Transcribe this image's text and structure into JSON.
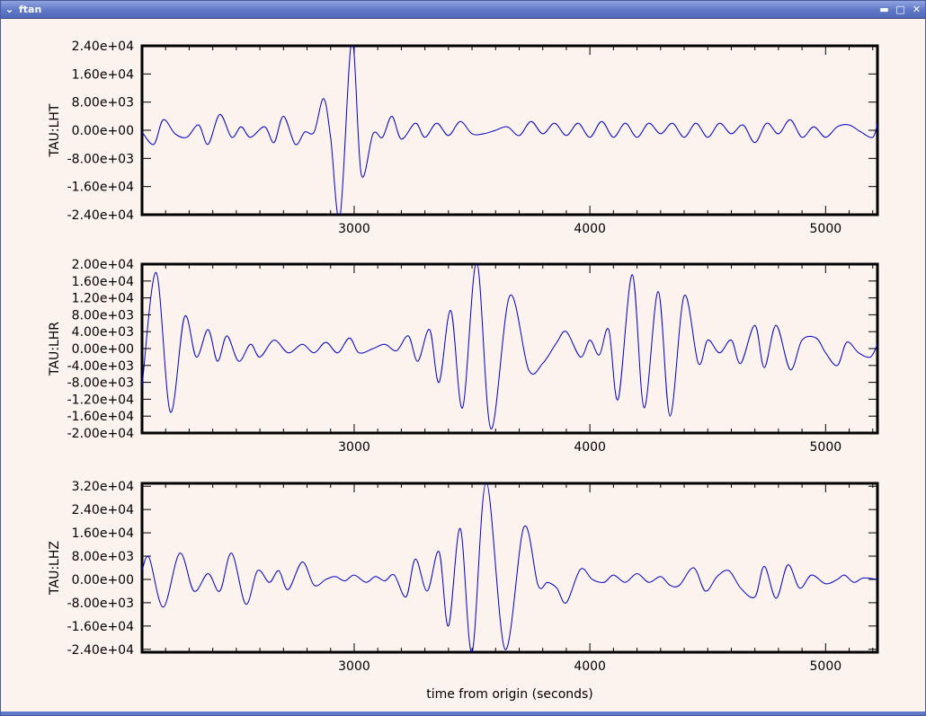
{
  "window": {
    "title": "ftan",
    "menu_icon": "chevron-down-icon",
    "minimize_icon": "minimize-icon",
    "maximize_icon": "maximize-icon",
    "close_icon": "close-icon"
  },
  "colors": {
    "trace": "#0000cc",
    "background": "#fcf2ee",
    "titlebar": "#5f78c8"
  },
  "xlabel": "time from origin (seconds)",
  "chart_data": [
    {
      "type": "line",
      "ylabel": "TAU:LHT",
      "xlim": [
        2100,
        5220
      ],
      "ylim": [
        -24000,
        24000
      ],
      "xticks": [
        "3000",
        "4000",
        "5000"
      ],
      "yticks": [
        "2.40e+04",
        "1.60e+04",
        "8.00e+03",
        "0.00e+00",
        "-8.00e+03",
        "-1.60e+04",
        "-2.40e+04"
      ],
      "series": [
        {
          "values": [
            [
              2100,
              -500
            ],
            [
              2150,
              -4000
            ],
            [
              2190,
              3000
            ],
            [
              2240,
              -1000
            ],
            [
              2290,
              -2000
            ],
            [
              2340,
              1500
            ],
            [
              2380,
              -4000
            ],
            [
              2430,
              4500
            ],
            [
              2480,
              -2000
            ],
            [
              2520,
              1000
            ],
            [
              2560,
              -2000
            ],
            [
              2620,
              1000
            ],
            [
              2660,
              -3500
            ],
            [
              2700,
              4000
            ],
            [
              2750,
              -4000
            ],
            [
              2790,
              -500
            ],
            [
              2830,
              -500
            ],
            [
              2870,
              9000
            ],
            [
              2900,
              -2000
            ],
            [
              2940,
              -24500
            ],
            [
              2990,
              25500
            ],
            [
              3030,
              -12500
            ],
            [
              3080,
              -1000
            ],
            [
              3120,
              -2000
            ],
            [
              3160,
              4000
            ],
            [
              3200,
              -2500
            ],
            [
              3260,
              2000
            ],
            [
              3300,
              -2000
            ],
            [
              3350,
              2000
            ],
            [
              3400,
              -1500
            ],
            [
              3450,
              2500
            ],
            [
              3500,
              -1000
            ],
            [
              3550,
              -1000
            ],
            [
              3600,
              0
            ],
            [
              3650,
              1000
            ],
            [
              3700,
              -1500
            ],
            [
              3750,
              2500
            ],
            [
              3800,
              -1000
            ],
            [
              3850,
              2000
            ],
            [
              3900,
              -1500
            ],
            [
              3950,
              2000
            ],
            [
              4000,
              -2000
            ],
            [
              4050,
              2500
            ],
            [
              4100,
              -2000
            ],
            [
              4150,
              2000
            ],
            [
              4200,
              -2000
            ],
            [
              4250,
              2000
            ],
            [
              4300,
              -1000
            ],
            [
              4350,
              2000
            ],
            [
              4400,
              -2000
            ],
            [
              4450,
              2000
            ],
            [
              4500,
              -2000
            ],
            [
              4550,
              2000
            ],
            [
              4600,
              -1000
            ],
            [
              4650,
              1500
            ],
            [
              4700,
              -3500
            ],
            [
              4750,
              2000
            ],
            [
              4800,
              -1000
            ],
            [
              4850,
              3000
            ],
            [
              4900,
              -2000
            ],
            [
              4950,
              1000
            ],
            [
              5000,
              -2000
            ],
            [
              5050,
              1000
            ],
            [
              5100,
              1500
            ],
            [
              5150,
              -500
            ],
            [
              5200,
              -2000
            ],
            [
              5220,
              2000
            ]
          ]
        }
      ]
    },
    {
      "type": "line",
      "ylabel": "TAU:LHR",
      "xlim": [
        2100,
        5220
      ],
      "ylim": [
        -20000,
        20000
      ],
      "xticks": [
        "3000",
        "4000",
        "5000"
      ],
      "yticks": [
        "2.00e+04",
        "1.60e+04",
        "1.20e+04",
        "8.00e+03",
        "4.00e+03",
        "0.00e+00",
        "-4.00e+03",
        "-8.00e+03",
        "-1.20e+04",
        "-1.60e+04",
        "-2.00e+04"
      ],
      "series": [
        {
          "values": [
            [
              2100,
              -9000
            ],
            [
              2160,
              18000
            ],
            [
              2220,
              -15000
            ],
            [
              2280,
              7500
            ],
            [
              2330,
              -2000
            ],
            [
              2380,
              4500
            ],
            [
              2420,
              -3000
            ],
            [
              2460,
              3000
            ],
            [
              2510,
              -3000
            ],
            [
              2560,
              1000
            ],
            [
              2600,
              -2000
            ],
            [
              2660,
              2000
            ],
            [
              2720,
              -1000
            ],
            [
              2780,
              1000
            ],
            [
              2830,
              -1000
            ],
            [
              2880,
              1500
            ],
            [
              2930,
              -1000
            ],
            [
              2980,
              2500
            ],
            [
              3020,
              -1000
            ],
            [
              3080,
              0
            ],
            [
              3130,
              1000
            ],
            [
              3180,
              -500
            ],
            [
              3230,
              3000
            ],
            [
              3270,
              -3000
            ],
            [
              3320,
              4500
            ],
            [
              3360,
              -8000
            ],
            [
              3410,
              9000
            ],
            [
              3460,
              -14000
            ],
            [
              3520,
              20500
            ],
            [
              3580,
              -19000
            ],
            [
              3660,
              12500
            ],
            [
              3740,
              -5000
            ],
            [
              3800,
              -3500
            ],
            [
              3860,
              1500
            ],
            [
              3900,
              4000
            ],
            [
              3960,
              -2000
            ],
            [
              4000,
              2000
            ],
            [
              4040,
              -1500
            ],
            [
              4080,
              4500
            ],
            [
              4120,
              -12000
            ],
            [
              4180,
              17500
            ],
            [
              4230,
              -14000
            ],
            [
              4290,
              13500
            ],
            [
              4340,
              -16000
            ],
            [
              4400,
              12500
            ],
            [
              4460,
              -3500
            ],
            [
              4500,
              2000
            ],
            [
              4550,
              -1000
            ],
            [
              4600,
              2000
            ],
            [
              4640,
              -3500
            ],
            [
              4700,
              5500
            ],
            [
              4740,
              -4500
            ],
            [
              4790,
              5500
            ],
            [
              4850,
              -5000
            ],
            [
              4900,
              2000
            ],
            [
              4960,
              2500
            ],
            [
              5000,
              -1000
            ],
            [
              5050,
              -4000
            ],
            [
              5090,
              1500
            ],
            [
              5140,
              -1000
            ],
            [
              5190,
              -2000
            ],
            [
              5220,
              1000
            ]
          ]
        }
      ]
    },
    {
      "type": "line",
      "ylabel": "TAU:LHZ",
      "xlim": [
        2100,
        5220
      ],
      "ylim": [
        -25000,
        33000
      ],
      "xticks": [
        "3000",
        "4000",
        "5000"
      ],
      "yticks": [
        "3.20e+04",
        "2.40e+04",
        "1.60e+04",
        "8.00e+03",
        "0.00e+00",
        "-8.00e+03",
        "-1.60e+04",
        "-2.40e+04"
      ],
      "series": [
        {
          "values": [
            [
              2100,
              3000
            ],
            [
              2130,
              7500
            ],
            [
              2190,
              -9500
            ],
            [
              2260,
              9000
            ],
            [
              2320,
              -4000
            ],
            [
              2380,
              2000
            ],
            [
              2430,
              -4000
            ],
            [
              2480,
              9000
            ],
            [
              2540,
              -8500
            ],
            [
              2590,
              3000
            ],
            [
              2640,
              -1000
            ],
            [
              2680,
              3000
            ],
            [
              2720,
              -3500
            ],
            [
              2780,
              6000
            ],
            [
              2830,
              -2000
            ],
            [
              2880,
              0
            ],
            [
              2920,
              1000
            ],
            [
              2960,
              -500
            ],
            [
              3000,
              1500
            ],
            [
              3050,
              -1000
            ],
            [
              3090,
              1000
            ],
            [
              3130,
              -500
            ],
            [
              3170,
              1500
            ],
            [
              3220,
              -6000
            ],
            [
              3260,
              7000
            ],
            [
              3310,
              -4000
            ],
            [
              3360,
              9500
            ],
            [
              3400,
              -16000
            ],
            [
              3450,
              17500
            ],
            [
              3500,
              -25000
            ],
            [
              3560,
              33500
            ],
            [
              3640,
              -24000
            ],
            [
              3720,
              18000
            ],
            [
              3780,
              -2000
            ],
            [
              3820,
              -1000
            ],
            [
              3860,
              -3000
            ],
            [
              3900,
              -8000
            ],
            [
              3960,
              3500
            ],
            [
              4010,
              0
            ],
            [
              4060,
              -1000
            ],
            [
              4100,
              1500
            ],
            [
              4150,
              -1000
            ],
            [
              4200,
              2000
            ],
            [
              4250,
              -1000
            ],
            [
              4300,
              1000
            ],
            [
              4340,
              -2000
            ],
            [
              4380,
              -2000
            ],
            [
              4440,
              4000
            ],
            [
              4490,
              -4000
            ],
            [
              4540,
              1000
            ],
            [
              4590,
              3000
            ],
            [
              4640,
              -3000
            ],
            [
              4700,
              -6000
            ],
            [
              4740,
              4500
            ],
            [
              4790,
              -6500
            ],
            [
              4840,
              5000
            ],
            [
              4890,
              -3000
            ],
            [
              4940,
              1500
            ],
            [
              5000,
              -1500
            ],
            [
              5050,
              0
            ],
            [
              5080,
              1500
            ],
            [
              5120,
              -1000
            ],
            [
              5160,
              500
            ],
            [
              5220,
              0
            ]
          ]
        }
      ]
    }
  ]
}
